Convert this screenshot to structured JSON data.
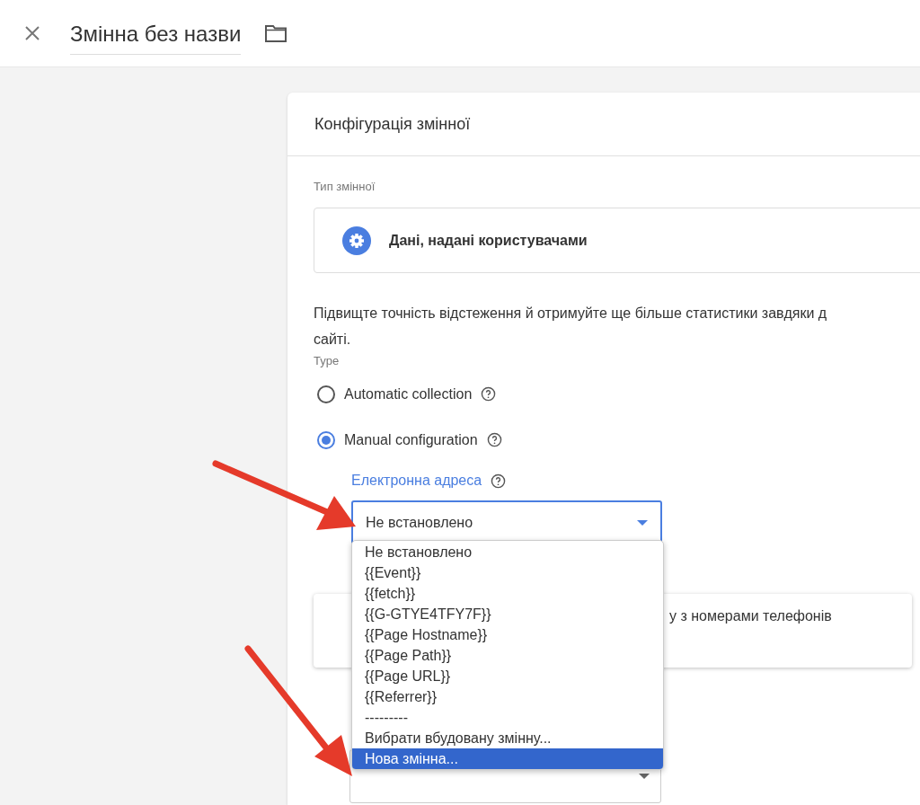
{
  "header": {
    "title": "Змінна без назви"
  },
  "card": {
    "title": "Конфігурація змінної",
    "type_label": "Тип змінної",
    "type_name": "Дані, надані користувачами",
    "description": "Підвищте точність відстеження й отримуйте ще більше статистики завдяки д\nсайті.",
    "section_label": "Type",
    "options": [
      {
        "label": "Automatic collection",
        "selected": false
      },
      {
        "label": "Manual configuration",
        "selected": true
      }
    ],
    "email_field": {
      "label": "Електронна адреса",
      "value": "Не встановлено",
      "focused": true
    },
    "menu": [
      {
        "label": "Не встановлено",
        "selected": false
      },
      {
        "label": "{{Event}}",
        "selected": false
      },
      {
        "label": "{{fetch}}",
        "selected": false
      },
      {
        "label": "{{G-GTYE4TFY7F}}",
        "selected": false
      },
      {
        "label": "{{Page Hostname}}",
        "selected": false
      },
      {
        "label": "{{Page Path}}",
        "selected": false
      },
      {
        "label": "{{Page URL}}",
        "selected": false
      },
      {
        "label": "{{Referrer}}",
        "selected": false
      },
      {
        "label": "---------",
        "selected": false
      },
      {
        "label": "Вибрати вбудовану змінну...",
        "selected": false
      },
      {
        "label": "Нова змінна...",
        "selected": true
      }
    ],
    "info_text": "у з номерами телефонів"
  }
}
